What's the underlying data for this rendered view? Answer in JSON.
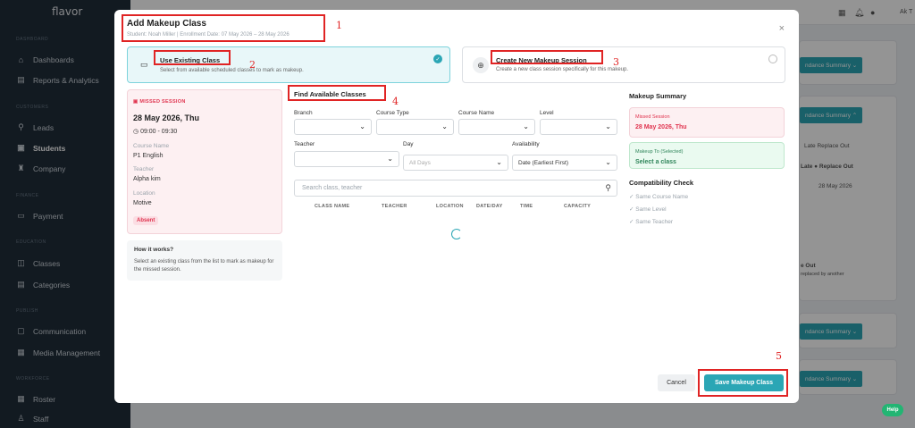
{
  "app": {
    "logo": "flavor"
  },
  "sidebar": {
    "sections": [
      {
        "label": "DASHBOARD",
        "items": [
          {
            "label": "Dashboards",
            "icon": "home-icon"
          },
          {
            "label": "Reports & Analytics",
            "icon": "report-icon"
          }
        ]
      },
      {
        "label": "CUSTOMERS",
        "items": [
          {
            "label": "Leads",
            "icon": "leads-icon"
          },
          {
            "label": "Students",
            "icon": "student-icon"
          },
          {
            "label": "Company",
            "icon": "company-icon"
          }
        ]
      },
      {
        "label": "FINANCE",
        "items": [
          {
            "label": "Payment",
            "icon": "payment-icon"
          }
        ]
      },
      {
        "label": "EDUCATION",
        "items": [
          {
            "label": "Classes",
            "icon": "classes-icon"
          },
          {
            "label": "Categories",
            "icon": "categories-icon"
          }
        ]
      },
      {
        "label": "PUBLISH",
        "items": [
          {
            "label": "Communication",
            "icon": "communication-icon"
          },
          {
            "label": "Media Management",
            "icon": "media-icon"
          }
        ]
      },
      {
        "label": "WORKFORCE",
        "items": [
          {
            "label": "Roster",
            "icon": "roster-icon"
          },
          {
            "label": "Staff",
            "icon": "staff-icon"
          }
        ]
      }
    ],
    "active": "Students"
  },
  "topbar": {
    "user": "Ak T"
  },
  "background": {
    "btn_label": "ndance Summary",
    "late_text": "Late  Replace Out",
    "late_header": "Late",
    "replace_header": "Replace Out",
    "date": "28 May 2026",
    "out_title": "e Out",
    "out_desc": "replaced by another"
  },
  "modal": {
    "title": "Add Makeup Class",
    "subtitle": "Student: Noah Miller | Enrollment Date: 07 May 2026 – 28 May 2026",
    "close": "×",
    "option_existing": {
      "title": "Use Existing Class",
      "desc": "Select from available scheduled classes to mark as makeup."
    },
    "option_new": {
      "title": "Create New Makeup Session",
      "desc": "Create a new class session specifically for this makeup."
    },
    "missed": {
      "label": "MISSED SESSION",
      "date": "28 May 2026, Thu",
      "time": "09:00 - 09:30",
      "course_label": "Course Name",
      "course": "P1 English",
      "teacher_label": "Teacher",
      "teacher": "Alpha kim",
      "location_label": "Location",
      "location": "Motive",
      "status": "Absent"
    },
    "how": {
      "title": "How it works?",
      "desc": "Select an existing class from the list to mark as makeup for the missed session."
    },
    "find": {
      "title": "Find Available Classes",
      "branch": "Branch",
      "course_type": "Course Type",
      "course_name": "Course Name",
      "level": "Level",
      "teacher": "Teacher",
      "day": "Day",
      "day_placeholder": "All Days",
      "availability": "Availability",
      "availability_value": "Date (Earliest First)",
      "search_placeholder": "Search class, teacher",
      "columns": [
        "CLASS NAME",
        "TEACHER",
        "LOCATION",
        "DATE/DAY",
        "TIME",
        "CAPACITY"
      ]
    },
    "summary": {
      "title": "Makeup Summary",
      "missed_label": "Missed Session",
      "missed_value": "28 May 2026, Thu",
      "to_label": "Makeup To (Selected)",
      "to_value": "Select a class",
      "compat_title": "Compatibility Check",
      "checks": [
        "Same Course Name",
        "Same Level",
        "Same Teacher"
      ]
    },
    "cancel": "Cancel",
    "save": "Save Makeup Class"
  },
  "annotations": [
    "1",
    "2",
    "3",
    "4",
    "5"
  ],
  "help": "Help"
}
